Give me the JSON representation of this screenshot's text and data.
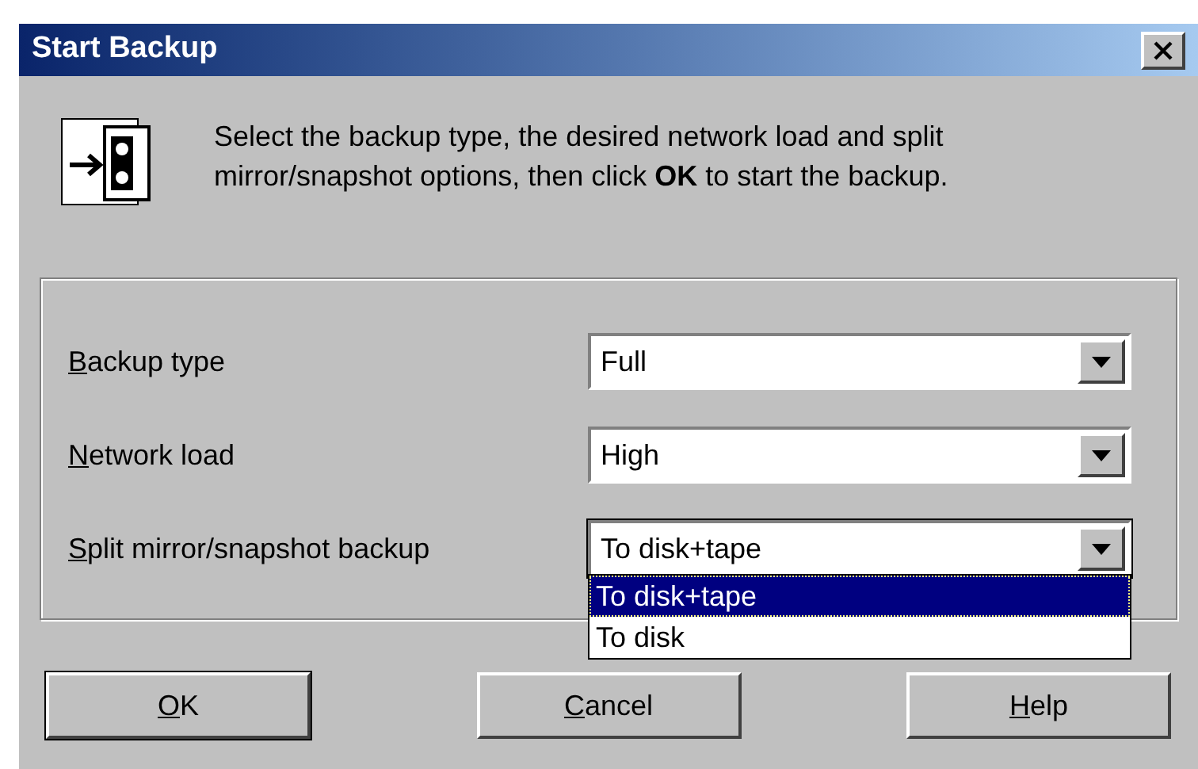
{
  "window": {
    "title": "Start Backup"
  },
  "instructions": "Select the backup type, the desired network load and split mirror/snapshot options, then click **OK** to start the backup.",
  "fields": [
    {
      "label": "Backup type",
      "value": "Full",
      "expanded": false
    },
    {
      "label": "Network load",
      "value": "High",
      "expanded": false
    },
    {
      "label": "Split mirror/snapshot backup",
      "value": "To disk+tape",
      "expanded": true,
      "options": [
        {
          "label": "To disk+tape",
          "selected": true
        },
        {
          "label": "To disk",
          "selected": false
        }
      ]
    }
  ],
  "buttons": [
    {
      "label": "OK",
      "default": true
    },
    {
      "label": "Cancel",
      "default": false
    },
    {
      "label": "Help",
      "default": false
    }
  ]
}
